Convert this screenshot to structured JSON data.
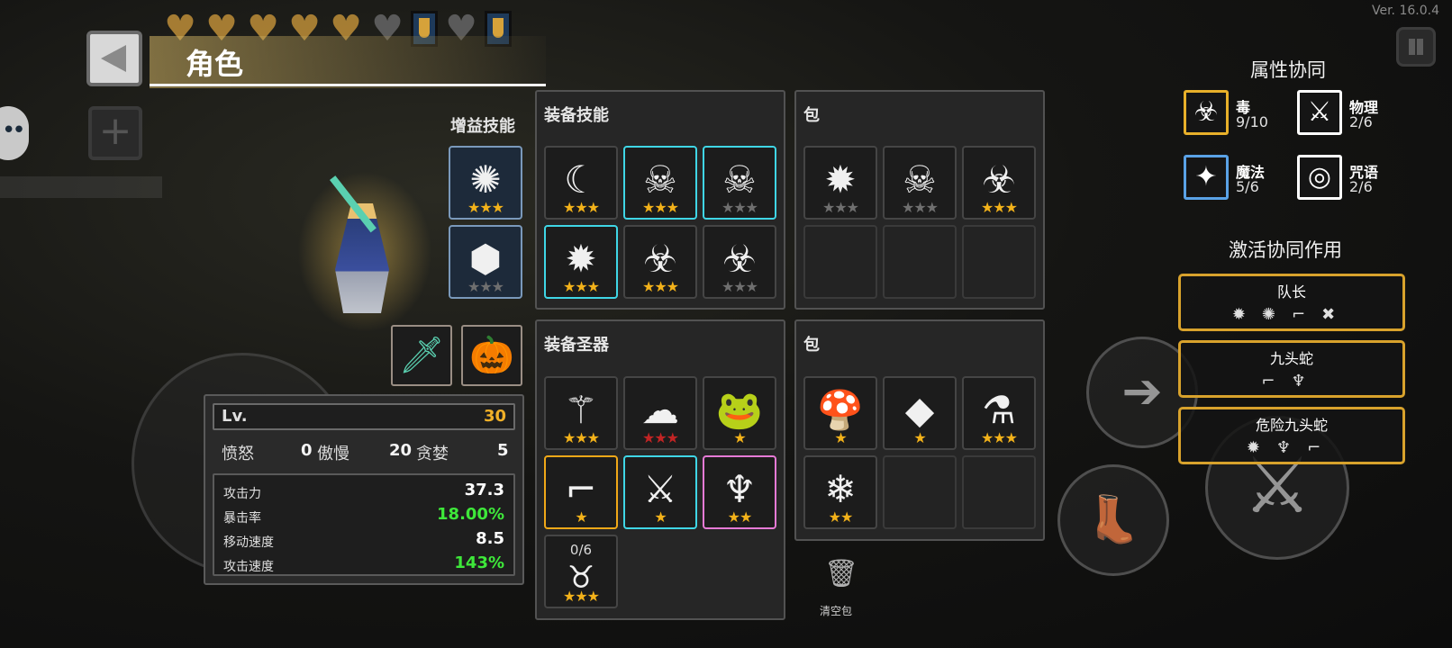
{
  "version": "Ver. 16.0.4",
  "title": "角色",
  "buff_skills": {
    "label": "增益技能",
    "items": [
      {
        "icon": "slash-swirl-icon",
        "glyph": "✺",
        "stars": [
          "on",
          "on",
          "on"
        ]
      },
      {
        "icon": "armor-orb-icon",
        "glyph": "⬢",
        "stars": [
          "off",
          "off",
          "off"
        ]
      }
    ]
  },
  "equipment": {
    "weapon": {
      "icon": "sword-icon",
      "glyph": "🗡"
    },
    "pet": {
      "icon": "pumpkin-pet-icon",
      "glyph": "🎃"
    }
  },
  "equip_skills": {
    "title": "装备技能",
    "cells": [
      {
        "icon": "claw-slash-icon",
        "glyph": "☾",
        "frame": "",
        "stars": [
          "on",
          "on",
          "on"
        ]
      },
      {
        "icon": "skull-burst-icon",
        "glyph": "☠",
        "frame": "frame-cyan",
        "stars": [
          "on",
          "on",
          "on"
        ]
      },
      {
        "icon": "skull-burst-icon",
        "glyph": "☠",
        "frame": "frame-cyan",
        "stars": [
          "off",
          "off",
          "off"
        ]
      },
      {
        "icon": "spark-burst-icon",
        "glyph": "✹",
        "frame": "frame-cyan",
        "stars": [
          "on",
          "on",
          "on"
        ]
      },
      {
        "icon": "biohazard-icon",
        "glyph": "☣",
        "frame": "",
        "stars": [
          "on",
          "on",
          "on"
        ]
      },
      {
        "icon": "biohazard-icon",
        "glyph": "☣",
        "frame": "",
        "stars": [
          "off",
          "off",
          "off"
        ]
      }
    ]
  },
  "skill_bag": {
    "title": "包",
    "cells": [
      {
        "icon": "spark-burst-icon",
        "glyph": "✹",
        "stars": [
          "off",
          "off",
          "off"
        ]
      },
      {
        "icon": "skull-burst-icon",
        "glyph": "☠",
        "stars": [
          "off",
          "off",
          "off"
        ]
      },
      {
        "icon": "biohazard-icon",
        "glyph": "☣",
        "stars": [
          "on",
          "on",
          "on"
        ]
      },
      {
        "empty": true
      },
      {
        "empty": true
      },
      {
        "empty": true
      }
    ]
  },
  "equip_relics": {
    "title": "装备圣器",
    "cells": [
      {
        "icon": "blood-staff-icon",
        "glyph": "⚚",
        "frame": "",
        "stars": [
          "on",
          "on",
          "on"
        ]
      },
      {
        "icon": "shadow-cloud-icon",
        "glyph": "☁",
        "frame": "",
        "stars": [
          "red",
          "red",
          "red"
        ]
      },
      {
        "icon": "frog-icon",
        "glyph": "🐸",
        "frame": "",
        "stars": [
          "on"
        ]
      },
      {
        "icon": "gun-icon",
        "glyph": "⌐",
        "frame": "frame-gold",
        "stars": [
          "on"
        ]
      },
      {
        "icon": "crossed-swords-icon",
        "glyph": "⚔",
        "frame": "frame-cyan",
        "stars": [
          "on"
        ]
      },
      {
        "icon": "dark-feather-icon",
        "glyph": "♆",
        "frame": "frame-pink",
        "stars": [
          "on",
          "on"
        ]
      },
      {
        "icon": "pouch-icon",
        "glyph": "♉",
        "frame": "",
        "stars": [
          "on",
          "on",
          "on"
        ],
        "count": "0/6"
      }
    ]
  },
  "relic_bag": {
    "title": "包",
    "cells": [
      {
        "icon": "mushroom-icon",
        "glyph": "🍄",
        "stars": [
          "on"
        ]
      },
      {
        "icon": "purple-crystal-icon",
        "glyph": "◆",
        "stars": [
          "on"
        ]
      },
      {
        "icon": "potion-flask-icon",
        "glyph": "⚗",
        "stars": [
          "on",
          "on",
          "on"
        ]
      },
      {
        "icon": "ice-crystal-icon",
        "glyph": "❄",
        "stars": [
          "on",
          "on"
        ]
      },
      {
        "empty": true
      },
      {
        "empty": true
      }
    ]
  },
  "stats": {
    "lv_label": "Lv.",
    "lv_value": "30",
    "traits": [
      {
        "label": "愤怒",
        "value": "0"
      },
      {
        "label": "傲慢",
        "value": "20"
      },
      {
        "label": "贪婪",
        "value": "5"
      }
    ],
    "attributes": [
      {
        "label": "攻击力",
        "value": "37.3",
        "color": "#ffffff"
      },
      {
        "label": "暴击率",
        "value": "18.00%",
        "color": "#3ee83a"
      },
      {
        "label": "移动速度",
        "value": "8.5",
        "color": "#ffffff"
      },
      {
        "label": "攻击速度",
        "value": "143%",
        "color": "#3ee83a"
      }
    ]
  },
  "synergy": {
    "title": "属性协同",
    "items": [
      {
        "name": "毒",
        "count": "9/10",
        "icon": "biohazard-icon",
        "glyph": "☣",
        "style": "gold"
      },
      {
        "name": "物理",
        "count": "2/6",
        "icon": "sword-icon",
        "glyph": "⚔",
        "style": ""
      },
      {
        "name": "魔法",
        "count": "5/6",
        "icon": "magic-star-icon",
        "glyph": "✦",
        "style": "blue"
      },
      {
        "name": "咒语",
        "count": "2/6",
        "icon": "spell-eye-icon",
        "glyph": "◎",
        "style": ""
      }
    ]
  },
  "active_synergy": {
    "title": "激活协同作用",
    "items": [
      {
        "name": "队长",
        "icons": "✹✺⌐✖"
      },
      {
        "name": "九头蛇",
        "icons": "⌐♆"
      },
      {
        "name": "危险九头蛇",
        "icons": "✹♆⌐"
      }
    ]
  },
  "clear_bag": {
    "label": "清空包",
    "icon": "trash-icon"
  },
  "colors": {
    "accent_gold": "#f0b028",
    "green": "#3ee83a",
    "cyan_frame": "#3fd6e6"
  }
}
